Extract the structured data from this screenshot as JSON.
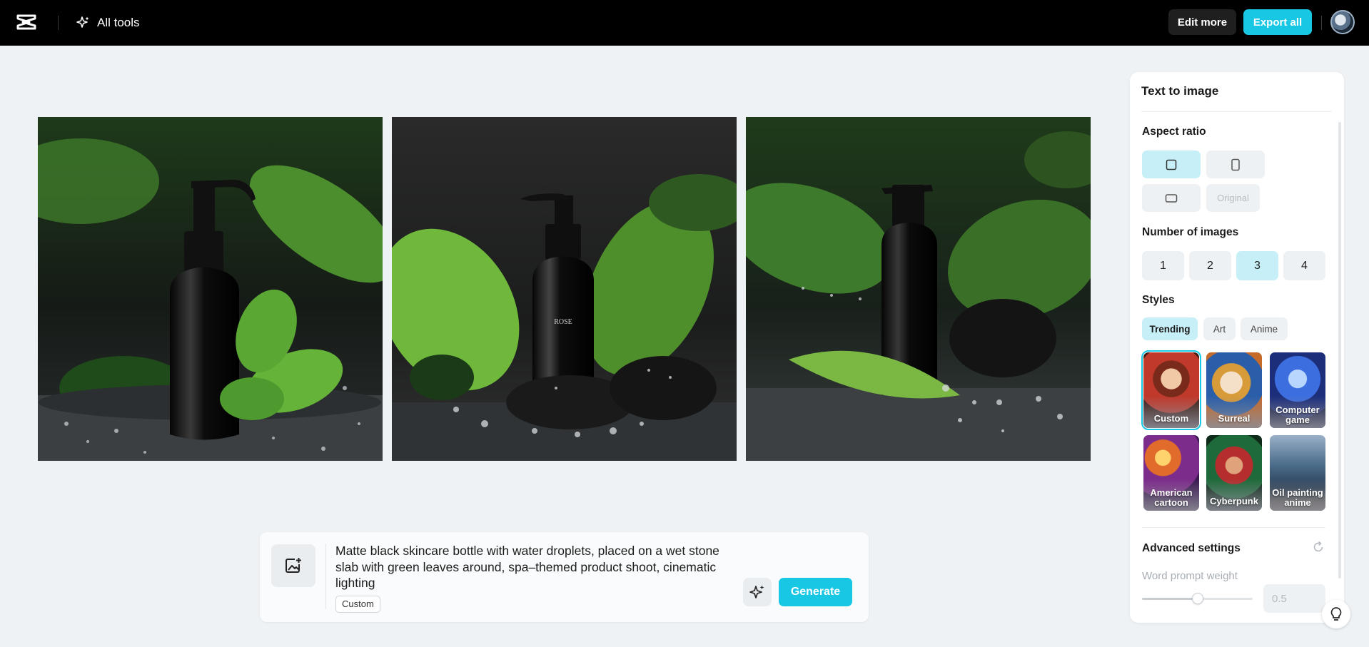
{
  "header": {
    "all_tools_label": "All tools",
    "edit_more_label": "Edit more",
    "export_all_label": "Export all"
  },
  "generated_images": [
    {
      "alt": "generated image 1"
    },
    {
      "alt": "generated image 2"
    },
    {
      "alt": "generated image 3"
    }
  ],
  "prompt": {
    "text": "Matte black skincare bottle with water droplets, placed on a wet stone slab with green leaves around, spa–themed product shoot, cinematic lighting",
    "style_tag": "Custom",
    "generate_label": "Generate"
  },
  "panel": {
    "title": "Text to image",
    "aspect_ratio": {
      "label": "Aspect ratio",
      "options": [
        "square",
        "portrait",
        "landscape",
        "Original"
      ],
      "selected": "square"
    },
    "number_of_images": {
      "label": "Number of images",
      "options": [
        "1",
        "2",
        "3",
        "4"
      ],
      "selected": "3"
    },
    "styles": {
      "label": "Styles",
      "tabs": [
        "Trending",
        "Art",
        "Anime"
      ],
      "selected_tab": "Trending",
      "items": [
        "Custom",
        "Surreal",
        "Computer game",
        "American cartoon",
        "Cyberpunk",
        "Oil painting anime"
      ],
      "selected": "Custom"
    },
    "advanced": {
      "label": "Advanced settings",
      "word_prompt_weight_label": "Word prompt weight",
      "word_prompt_weight_value": "0.5",
      "slider_fraction": 0.5
    }
  },
  "colors": {
    "accent": "#18c7e3",
    "selected_bg": "#c7eff7",
    "page_bg": "#eef2f5"
  }
}
